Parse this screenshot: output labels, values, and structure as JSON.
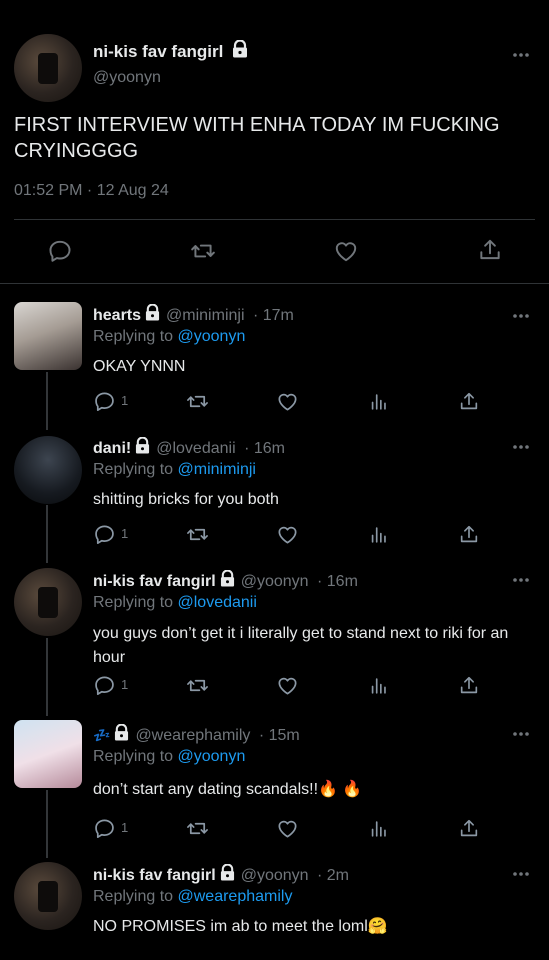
{
  "main_tweet": {
    "display_name": "ni-kis fav fangirl",
    "handle": "@yoonyn",
    "text": "FIRST INTERVIEW WITH ENHA TODAY IM FUCKING CRYINGGGG",
    "timestamp": "01:52 PM · 12 Aug 24"
  },
  "replies": [
    {
      "display_name": "hearts",
      "handle": "@miniminji",
      "time": "· 17m",
      "replying_prefix": "Replying to ",
      "replying_to": "@yoonyn",
      "text": "OKAY YNNN",
      "reply_count": "1"
    },
    {
      "display_name": "dani!",
      "handle": "@lovedanii",
      "time": "· 16m",
      "replying_prefix": "Replying to ",
      "replying_to": "@miniminji",
      "text": "shitting bricks for you both",
      "reply_count": "1"
    },
    {
      "display_name": "ni-kis fav fangirl",
      "handle": "@yoonyn",
      "time": "· 16m",
      "replying_prefix": "Replying to ",
      "replying_to": "@lovedanii",
      "text": "you guys don’t get it i literally get to stand next to riki for an hour",
      "reply_count": "1"
    },
    {
      "display_name": "💤",
      "handle": "@wearephamily",
      "time": "· 15m",
      "replying_prefix": "Replying to ",
      "replying_to": "@yoonyn",
      "text": "don’t start any dating scandals!!🔥 🔥",
      "reply_count": "1"
    },
    {
      "display_name": "ni-kis fav fangirl",
      "handle": "@yoonyn",
      "time": "· 2m",
      "replying_prefix": "Replying to ",
      "replying_to": "@wearephamily",
      "text": "NO PROMISES im ab to meet the loml🤗"
    }
  ],
  "icons": {
    "reply": "reply-icon",
    "retweet": "retweet-icon",
    "like": "like-icon",
    "views": "views-icon",
    "share": "share-icon",
    "lock": "lock-icon",
    "more": "more-icon"
  },
  "colors": {
    "background": "#000000",
    "text": "#e7e9ea",
    "muted": "#71767b",
    "accent": "#1d9bf0"
  }
}
